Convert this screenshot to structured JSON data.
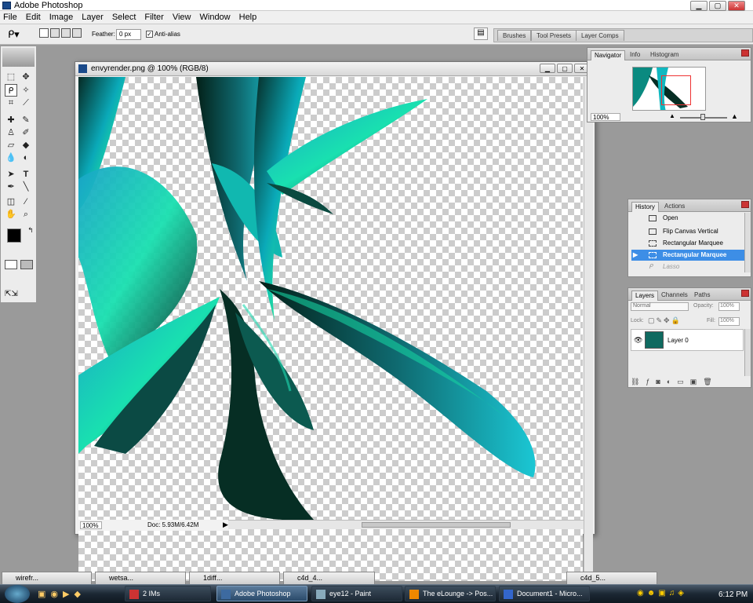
{
  "app": {
    "title": "Adobe Photoshop"
  },
  "menu": [
    "File",
    "Edit",
    "Image",
    "Layer",
    "Select",
    "Filter",
    "View",
    "Window",
    "Help"
  ],
  "options_bar": {
    "feather_label": "Feather:",
    "feather_value": "0 px",
    "antialias_label": "Anti-alias",
    "antialias_checked": true
  },
  "palette_well": [
    "Brushes",
    "Tool Presets",
    "Layer Comps"
  ],
  "document": {
    "title": "envyrender.png @ 100% (RGB/8)",
    "zoom": "100%",
    "doc_size": "Doc: 5.93M/6.42M"
  },
  "navigator": {
    "tabs": [
      "Navigator",
      "Info",
      "Histogram"
    ],
    "active_tab": "Navigator",
    "zoom": "100%"
  },
  "history": {
    "tabs": [
      "History",
      "Actions"
    ],
    "active_tab": "History",
    "items": [
      {
        "label": "Open",
        "state": "normal"
      },
      {
        "label": "Flip Canvas Vertical",
        "state": "normal"
      },
      {
        "label": "Rectangular Marquee",
        "state": "normal"
      },
      {
        "label": "Rectangular Marquee",
        "state": "selected"
      },
      {
        "label": "Lasso",
        "state": "greyed"
      }
    ]
  },
  "layers": {
    "tabs": [
      "Layers",
      "Channels",
      "Paths"
    ],
    "active_tab": "Layers",
    "blend_mode": "Normal",
    "opacity_label": "Opacity:",
    "opacity": "100%",
    "lock_label": "Lock:",
    "fill_label": "Fill:",
    "fill": "100%",
    "items": [
      {
        "name": "Layer 0",
        "visible": true
      }
    ]
  },
  "minimized_windows": [
    {
      "label": "wirefr..."
    },
    {
      "label": "wetsa..."
    },
    {
      "label": "1diff..."
    },
    {
      "label": "c4d_4..."
    },
    {
      "label": "c4d_5..."
    }
  ],
  "taskbar": {
    "buttons": [
      {
        "label": "2 IMs",
        "active": false
      },
      {
        "label": "Adobe Photoshop",
        "active": true
      },
      {
        "label": "eye12 - Paint",
        "active": false
      },
      {
        "label": "The eLounge -> Pos...",
        "active": false
      },
      {
        "label": "Document1 - Micro...",
        "active": false
      }
    ],
    "clock": "6:12 PM"
  },
  "colors": {
    "accent_selected": "#3d8ee6",
    "render_teal": "#19c7c7",
    "render_green": "#1fd88a",
    "render_dark": "#06281f"
  }
}
